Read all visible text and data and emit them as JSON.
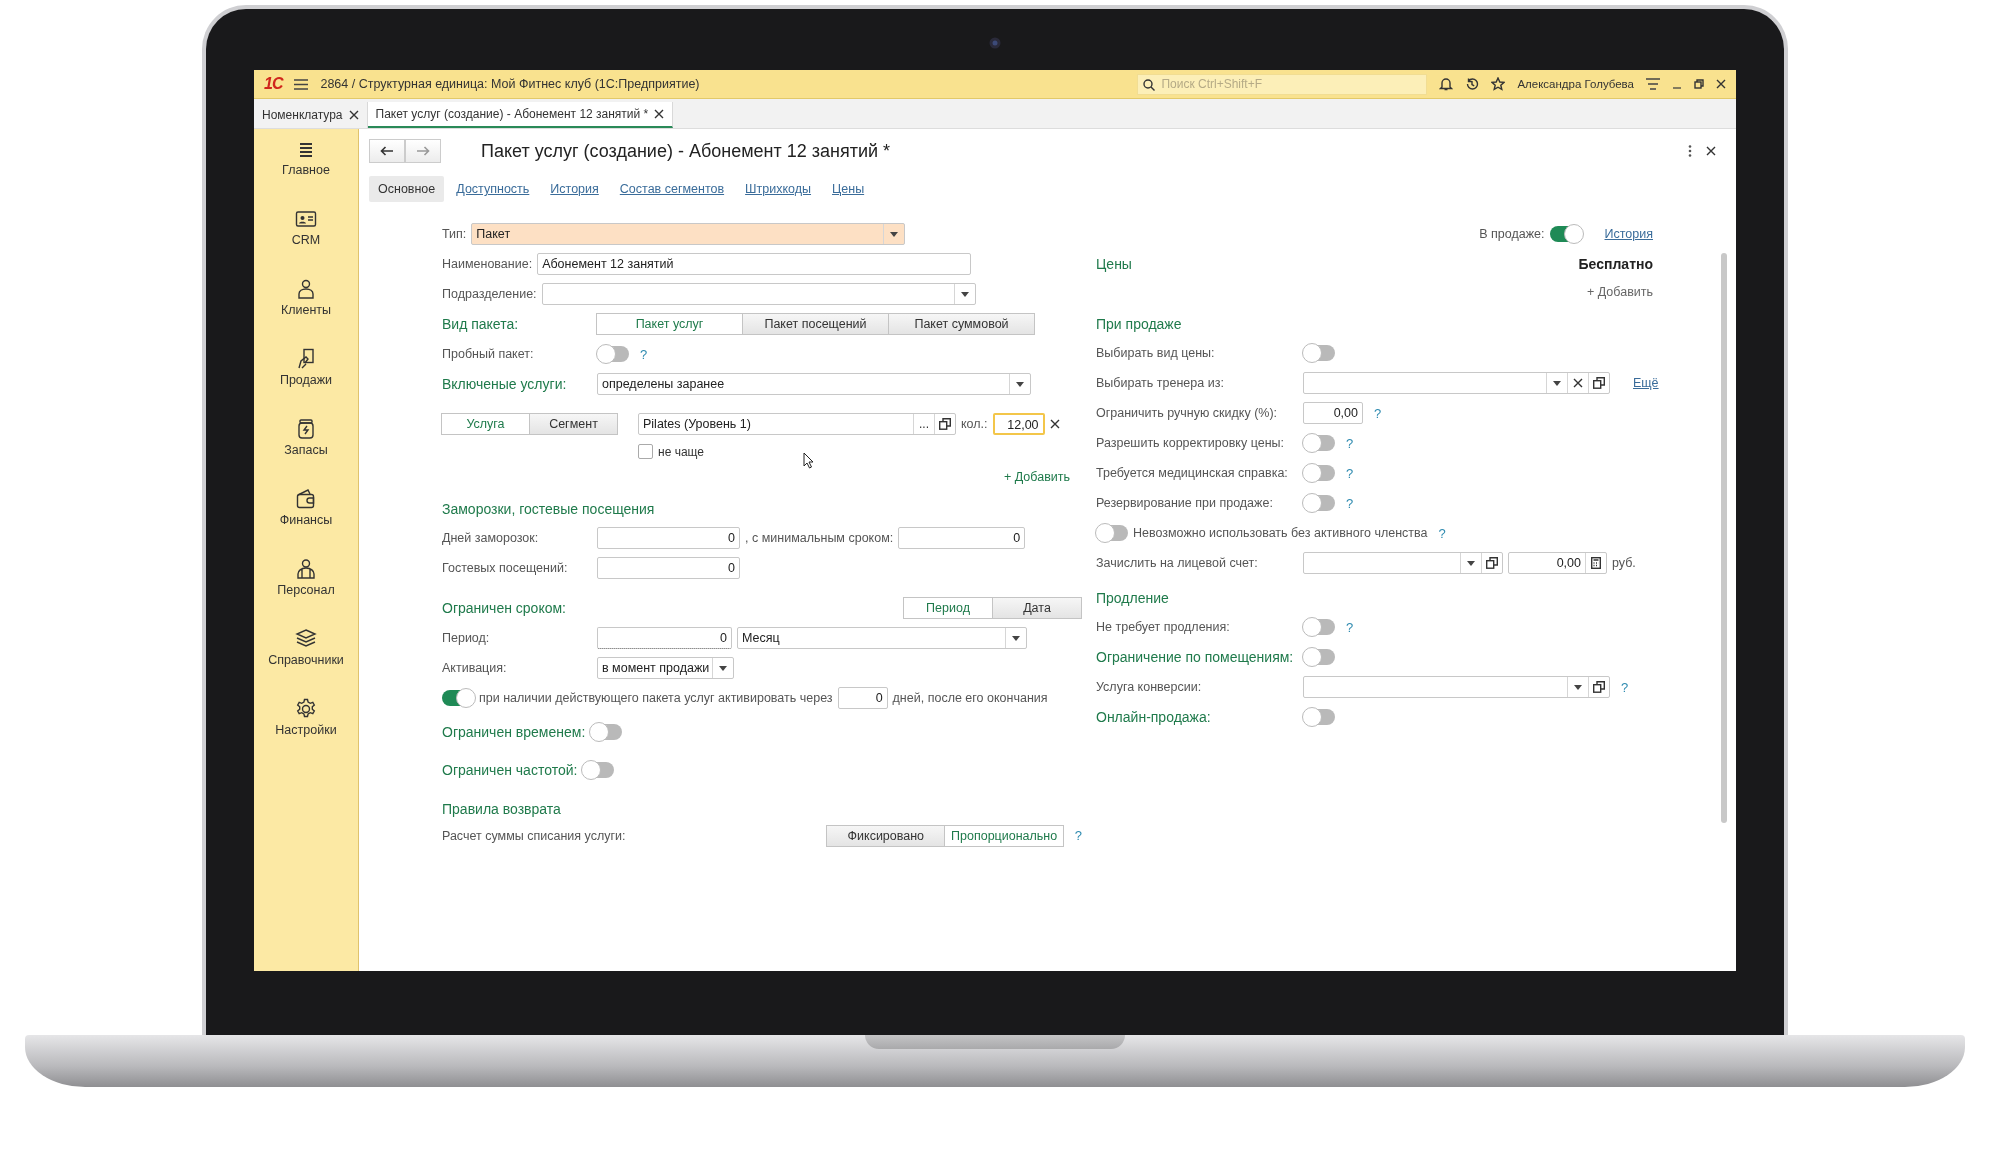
{
  "app_bar": {
    "logo": "1С",
    "title": "2864 / Структурная единица: Мой Фитнес клуб  (1С:Предприятие)",
    "search": {
      "placeholder": "Поиск Ctrl+Shift+F"
    },
    "user": "Александра Голубева"
  },
  "open_tabs": [
    {
      "label": "Номенклатура",
      "selected": false
    },
    {
      "label": "Пакет услуг (создание) - Абонемент 12 занятий *",
      "selected": true
    }
  ],
  "sidebar": {
    "items": [
      {
        "label": "Главное"
      },
      {
        "label": "CRM"
      },
      {
        "label": "Клиенты"
      },
      {
        "label": "Продажи"
      },
      {
        "label": "Запасы"
      },
      {
        "label": "Финансы"
      },
      {
        "label": "Персонал"
      },
      {
        "label": "Справочники"
      },
      {
        "label": "Настройки"
      }
    ]
  },
  "form": {
    "title": "Пакет услуг (создание) - Абонемент 12 занятий *",
    "tabs": [
      {
        "label": "Основное",
        "selected": true
      },
      {
        "label": "Доступность",
        "selected": false
      },
      {
        "label": "История",
        "selected": false
      },
      {
        "label": "Состав сегментов",
        "selected": false
      },
      {
        "label": "Штрихкоды",
        "selected": false
      },
      {
        "label": "Цены",
        "selected": false
      }
    ],
    "left": {
      "type": {
        "label": "Тип:",
        "value": "Пакет",
        "highlighted": true
      },
      "name": {
        "label": "Наименование:",
        "value": "Абонемент 12 занятий"
      },
      "division": {
        "label": "Подразделение:"
      },
      "package_kind": {
        "label": "Вид пакета:",
        "options": [
          {
            "label": "Пакет услуг",
            "selected": true
          },
          {
            "label": "Пакет посещений",
            "selected": false
          },
          {
            "label": "Пакет суммовой",
            "selected": false
          }
        ]
      },
      "trial": {
        "label": "Пробный пакет:",
        "on": false,
        "help": "?"
      },
      "included": {
        "label": "Включеные услуги:",
        "value": "определены заранее"
      },
      "service_line": {
        "modes": [
          {
            "label": "Услуга",
            "selected": true
          },
          {
            "label": "Сегмент",
            "selected": false
          }
        ],
        "service": "Pilates (Уровень 1)",
        "choose": "...",
        "qty_label": "кол.:",
        "qty": "12,00",
        "focused": true,
        "not_more_often": {
          "label": "не чаще",
          "checked": false
        }
      },
      "add_service": "+ Добавить",
      "freeze": {
        "heading": "Заморозки, гостевые посещения",
        "days": {
          "label": "Дней заморозок:",
          "value": "0"
        },
        "min_term": {
          "label": ", с минимальным сроком:",
          "value": "0"
        },
        "guests": {
          "label": "Гостевых посещений:",
          "value": "0"
        }
      },
      "term": {
        "label": "Ограничен сроком:",
        "modes": [
          {
            "label": "Период",
            "selected": true
          },
          {
            "label": "Дата",
            "selected": false
          }
        ],
        "period": {
          "label": "Период:",
          "value": "0",
          "unit": "Месяц"
        },
        "activation": {
          "label": "Активация:",
          "value": "в момент продажи"
        },
        "auto": {
          "on": true,
          "text": "при наличии действующего пакета услуг активировать через",
          "days": "0",
          "suffix": "дней, после его окончания"
        }
      },
      "time_limit": {
        "label": "Ограничен временем:",
        "on": false
      },
      "frequency_limit": {
        "label": "Ограничен частотой:",
        "on": false
      },
      "refund": {
        "heading": "Правила возврата",
        "label": "Расчет суммы списания услуги:",
        "options": [
          {
            "label": "Фиксировано",
            "selected": false
          },
          {
            "label": "Пропорционально",
            "selected": true
          }
        ],
        "help": "?"
      }
    },
    "right": {
      "on_sale": {
        "label": "В продаже:",
        "on": true,
        "link": "История"
      },
      "prices": {
        "heading": "Цены",
        "value": "Бесплатно",
        "add": "+ Добавить"
      },
      "rows": [
        {
          "kind": "heading",
          "text": "При продаже"
        },
        {
          "kind": "toggle",
          "label": "Выбирать вид цены:",
          "on": false,
          "emphasis": false
        },
        {
          "kind": "select",
          "label": "Выбирать тренера из:",
          "clearable": true,
          "link": "Ещё"
        },
        {
          "kind": "number",
          "label": "Ограничить ручную скидку (%):",
          "value": "0,00",
          "help": "?"
        },
        {
          "kind": "toggle",
          "label": "Разрешить корректировку цены:",
          "on": false,
          "emphasis": false,
          "help": "?"
        },
        {
          "kind": "toggle",
          "label": "Требуется медицинская справка:",
          "on": false,
          "emphasis": false,
          "help": "?"
        },
        {
          "kind": "toggle",
          "label": "Резервирование при продаже:",
          "on": false,
          "emphasis": false,
          "help": "?"
        },
        {
          "kind": "toggle_inline",
          "label": "Невозможно использовать без активного членства",
          "on": false,
          "help": "?"
        },
        {
          "kind": "account",
          "label": "Зачислить на лицевой счет:",
          "amount": "0,00",
          "unit": "руб."
        },
        {
          "kind": "heading",
          "text": "Продление"
        },
        {
          "kind": "toggle",
          "label": "Не требует продления:",
          "on": false,
          "emphasis": false,
          "help": "?"
        },
        {
          "kind": "toggle",
          "label": "Ограничение по помещениям:",
          "on": false,
          "emphasis": true
        },
        {
          "kind": "select",
          "label": "Услуга конверсии:",
          "clearable": false,
          "help": "?"
        },
        {
          "kind": "toggle",
          "label": "Онлайн-продажа:",
          "on": false,
          "emphasis": true
        }
      ]
    }
  }
}
